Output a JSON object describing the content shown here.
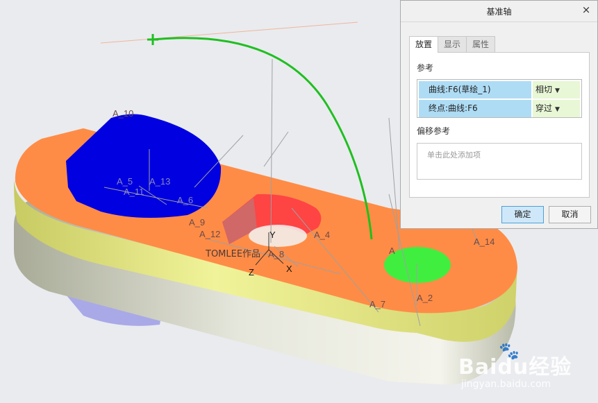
{
  "dialog": {
    "title": "基准轴",
    "close_glyph": "×",
    "tabs": [
      {
        "label": "放置",
        "active": true
      },
      {
        "label": "显示",
        "active": false
      },
      {
        "label": "属性",
        "active": false
      }
    ],
    "references_heading": "参考",
    "references": [
      {
        "ref": "曲线:F6(草绘_1)",
        "mode": "相切"
      },
      {
        "ref": "终点:曲线:F6",
        "mode": "穿过"
      }
    ],
    "offset_heading": "偏移参考",
    "offset_placeholder": "单击此处添加项",
    "ok_label": "确定",
    "cancel_label": "取消"
  },
  "model": {
    "axis_labels": [
      "A_10",
      "A_5",
      "A_13",
      "A_11",
      "A_6",
      "A_9",
      "A_12",
      "A_4",
      "A_8",
      "A",
      "A_14",
      "A_7",
      "A_2"
    ],
    "csys": {
      "y": "Y",
      "x": "X",
      "z": "Z"
    },
    "author_text": "TOMLEE作品",
    "colors": {
      "top_face": "#ff8c46",
      "side_face": "#e3e67a",
      "lower_plate": "#c8cab9",
      "boss": "#0000e0",
      "cut": "#ff4040",
      "hole": "#40ee40",
      "sketch": "#1fbf1f",
      "pin": "#9aa4ae"
    }
  },
  "watermark": {
    "brand": "Baidu经验",
    "url": "jingyan.baidu.com"
  }
}
